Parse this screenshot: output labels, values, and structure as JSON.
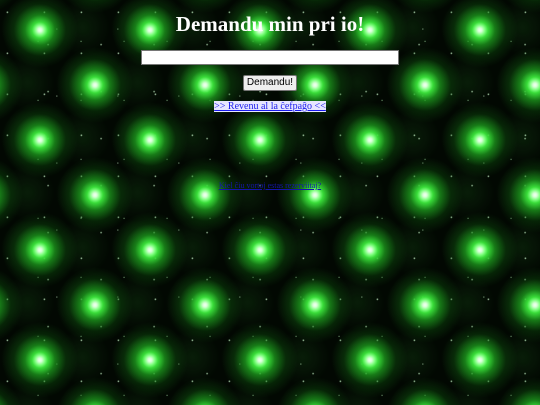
{
  "heading": "Demandu min pri io!",
  "question_field": {
    "value": "",
    "placeholder": ""
  },
  "ask_button_label": "Demandu!",
  "back_link_label": ">> Revenu al la ĉefpaĝo <<",
  "bottom_link_label": "Kiel ĉiu vortoj estas rezerviitaj?",
  "colors": {
    "background": "#020802",
    "star_glow": "#3ce63c",
    "heading": "#ffffff",
    "link": "#1a1aee"
  }
}
